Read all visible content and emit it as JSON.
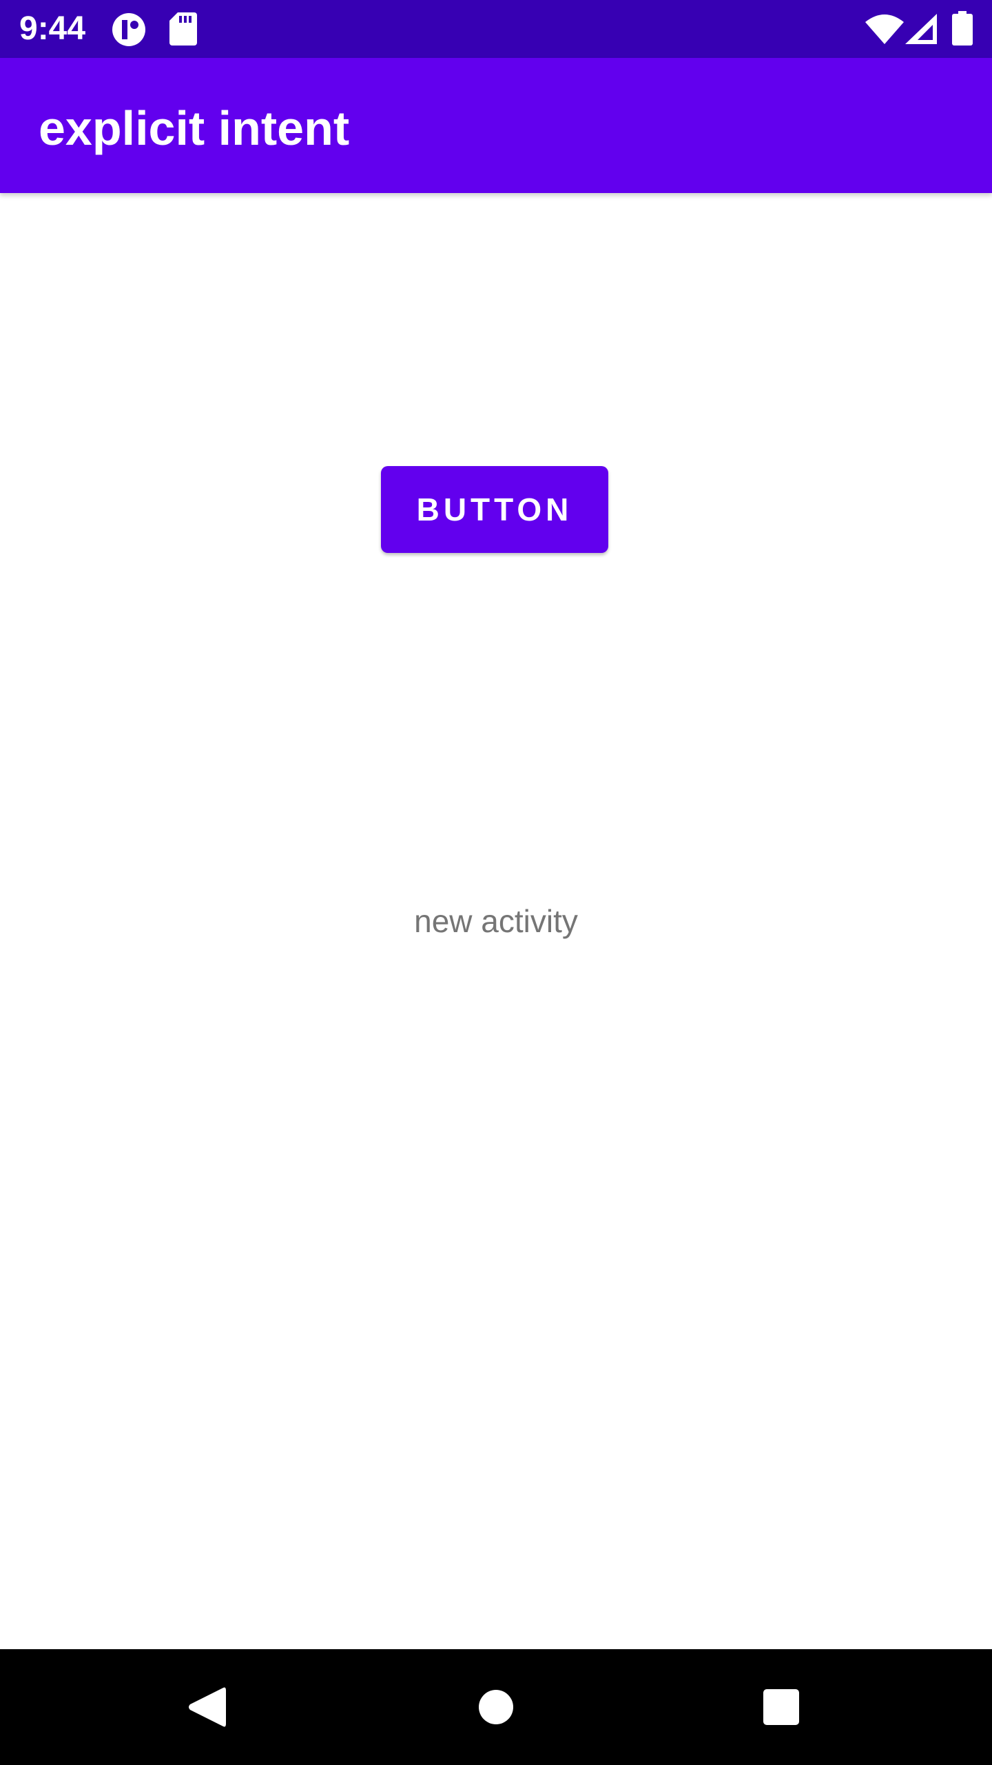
{
  "status_bar": {
    "time": "9:44",
    "icons": [
      "app-notification-icon",
      "sd-card-icon",
      "wifi-icon",
      "cell-signal-icon",
      "battery-icon"
    ],
    "background": "#3700b3"
  },
  "app_bar": {
    "title": "explicit intent",
    "background": "#6200ee"
  },
  "main": {
    "button_label": "BUTTON",
    "text": "new activity",
    "accent": "#6200ee"
  },
  "nav_bar": {
    "icons": [
      "back-icon",
      "home-icon",
      "recents-icon"
    ]
  }
}
